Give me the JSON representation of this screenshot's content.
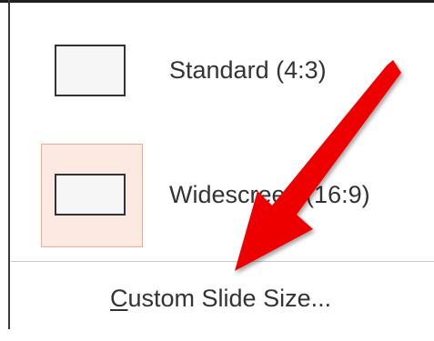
{
  "slide_size_menu": {
    "options": [
      {
        "label": "Standard (4:3)",
        "selected": false
      },
      {
        "label": "Widescreen (16:9)",
        "selected": true
      }
    ],
    "custom": {
      "access_key": "C",
      "label_rest": "ustom Slide Size..."
    }
  },
  "colors": {
    "selected_fill": "#fbe9e2",
    "selected_border": "#f1a98f",
    "annotation_arrow": "#ee0000"
  },
  "icons": {
    "annotation": "red-arrow-icon"
  }
}
